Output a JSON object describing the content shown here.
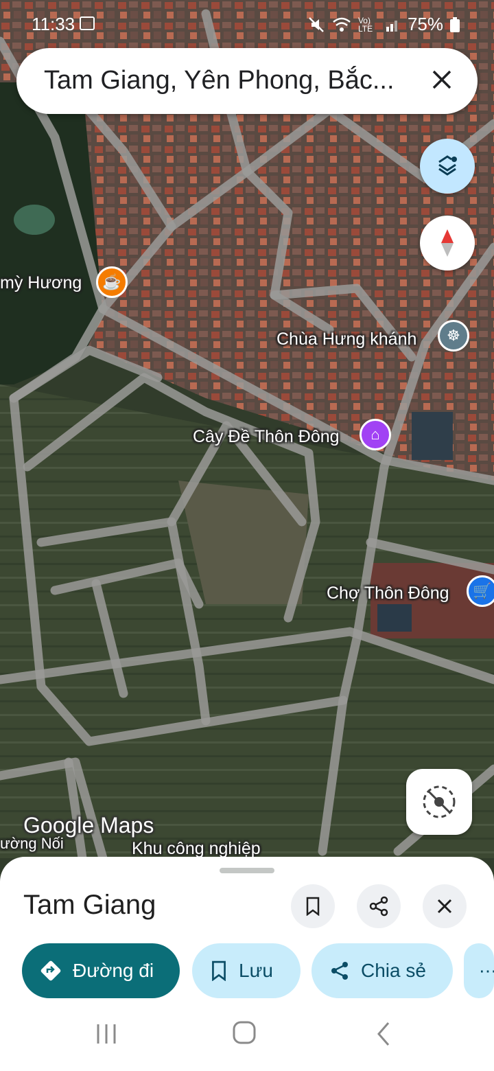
{
  "status_bar": {
    "time": "11:33",
    "network": "Vo) LTE",
    "battery": "75%"
  },
  "search": {
    "query": "Tam Giang, Yên Phong, Bắc..."
  },
  "map": {
    "watermark": "Google Maps",
    "places": [
      {
        "name": "mỳ Hương",
        "icon": "cafe-icon",
        "color": "#f57c00"
      },
      {
        "name": "Chùa Hưng khánh",
        "icon": "temple-icon",
        "color": "#607d8b"
      },
      {
        "name": "Cây Đề Thôn Đông",
        "icon": "museum-icon",
        "color": "#a142f4"
      },
      {
        "name": "Chợ Thôn Đông",
        "icon": "shopping-cart-icon",
        "color": "#1a73e8"
      }
    ],
    "road_labels": [
      "ường Nối",
      "Khu công nghiệp"
    ]
  },
  "place_sheet": {
    "title": "Tam Giang",
    "actions": [
      {
        "label": "Đường đi",
        "icon": "directions-icon"
      },
      {
        "label": "Lưu",
        "icon": "bookmark-icon"
      },
      {
        "label": "Chia sẻ",
        "icon": "share-icon"
      }
    ]
  },
  "colors": {
    "primary": "#0b6e78",
    "chip_bg": "#c8ecfb",
    "layers_bg": "#c2e7ff"
  }
}
